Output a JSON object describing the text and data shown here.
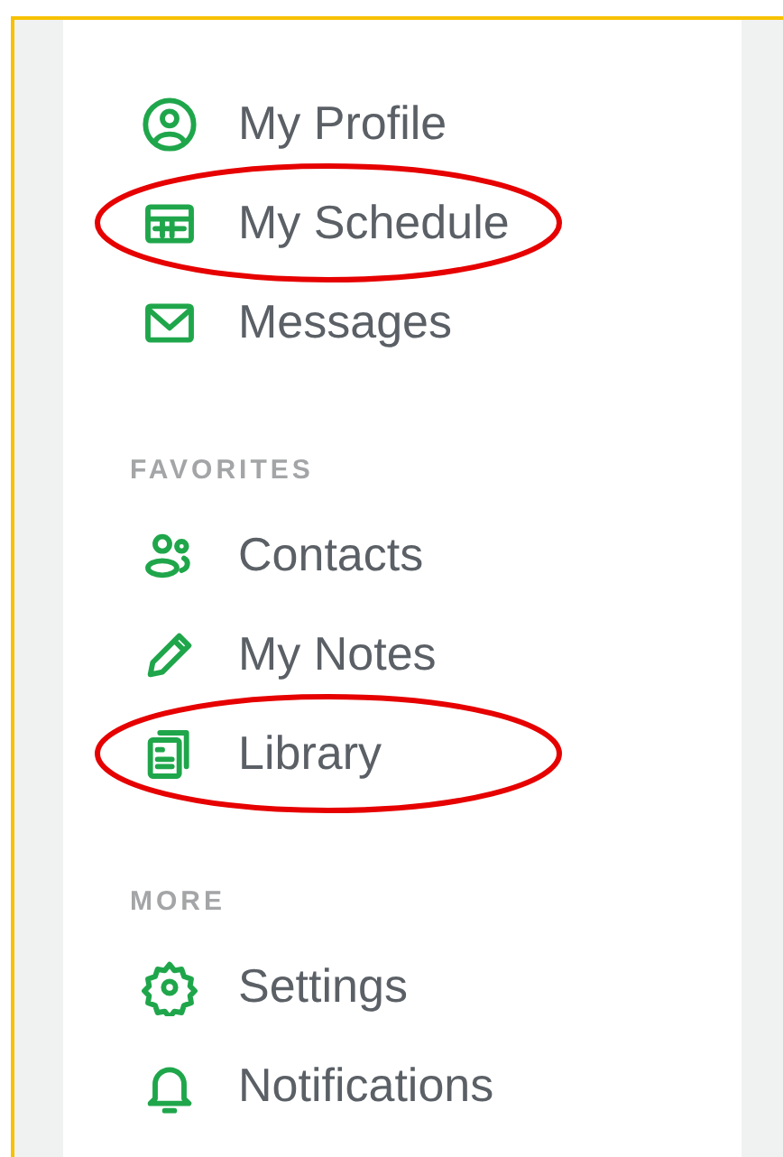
{
  "sections": [
    {
      "items": [
        {
          "label": "My Profile",
          "highlighted": false
        },
        {
          "label": "My Schedule",
          "highlighted": true
        },
        {
          "label": "Messages",
          "highlighted": false
        }
      ]
    },
    {
      "heading": "FAVORITES",
      "items": [
        {
          "label": "Contacts",
          "highlighted": false
        },
        {
          "label": "My Notes",
          "highlighted": false
        },
        {
          "label": "Library",
          "highlighted": true
        }
      ]
    },
    {
      "heading": "MORE",
      "items": [
        {
          "label": "Settings",
          "highlighted": false
        },
        {
          "label": "Notifications",
          "highlighted": false
        }
      ]
    }
  ]
}
